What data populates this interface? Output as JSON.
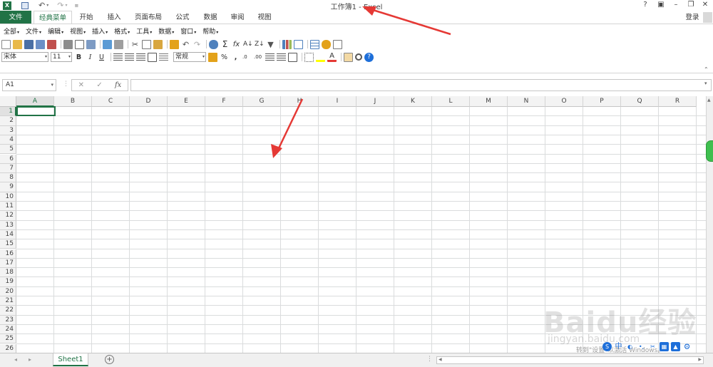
{
  "window": {
    "title": "工作簿1 - Excel",
    "help_icon": "?",
    "login_label": "登录"
  },
  "tabs": [
    {
      "label": "文件"
    },
    {
      "label": "经典菜单"
    },
    {
      "label": "开始"
    },
    {
      "label": "插入"
    },
    {
      "label": "页面布局"
    },
    {
      "label": "公式"
    },
    {
      "label": "数据"
    },
    {
      "label": "审阅"
    },
    {
      "label": "视图"
    }
  ],
  "menu": [
    {
      "label": "全部"
    },
    {
      "label": "文件"
    },
    {
      "label": "编辑"
    },
    {
      "label": "视图"
    },
    {
      "label": "插入"
    },
    {
      "label": "格式"
    },
    {
      "label": "工具"
    },
    {
      "label": "数据"
    },
    {
      "label": "窗口"
    },
    {
      "label": "帮助"
    }
  ],
  "toolbar": {
    "font_name": "宋体",
    "font_size": "11",
    "bold": "B",
    "italic": "I",
    "underline": "U",
    "number_format": "常规",
    "percent": "%",
    "comma": ","
  },
  "formula_bar": {
    "name_box": "A1",
    "fx_label": "fx",
    "content": ""
  },
  "sheet": {
    "columns": [
      "A",
      "B",
      "C",
      "D",
      "E",
      "F",
      "G",
      "H",
      "I",
      "J",
      "K",
      "L",
      "M",
      "N",
      "O",
      "P",
      "Q",
      "R"
    ],
    "rows": [
      "1",
      "2",
      "3",
      "4",
      "5",
      "6",
      "7",
      "8",
      "9",
      "10",
      "11",
      "12",
      "13",
      "14",
      "15",
      "16",
      "17",
      "18",
      "19",
      "20",
      "21",
      "22",
      "23",
      "24",
      "25",
      "26"
    ],
    "active_cell": "A1",
    "tab_name": "Sheet1"
  },
  "overlay": {
    "watermark_brand": "Baidu经验",
    "watermark_url": "jingyan.baidu.com",
    "activation_text": "转到\"设置\"以激活 Windows。"
  },
  "colors": {
    "excel_green": "#217346",
    "arrow_red": "#e53935"
  }
}
